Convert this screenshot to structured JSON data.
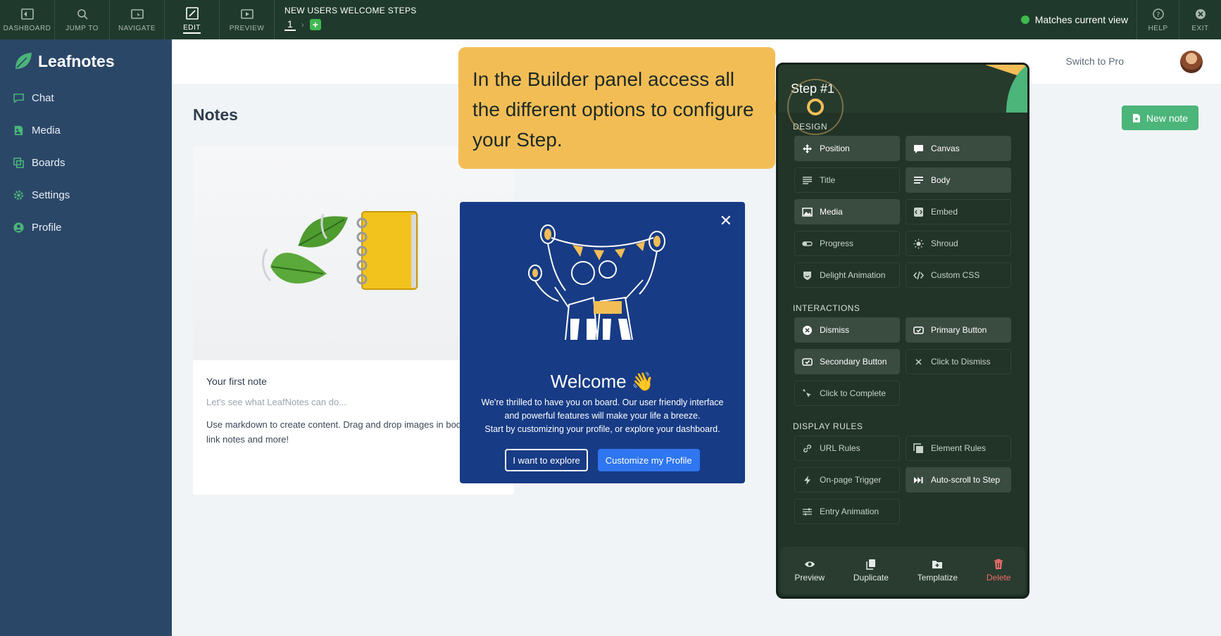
{
  "toolbar": {
    "dashboard": "DASHBOARD",
    "jump_to": "JUMP TO",
    "navigate": "NAVIGATE",
    "edit": "EDIT",
    "preview": "PREVIEW",
    "flow_name": "NEW USERS WELCOME STEPS",
    "current_step": "1",
    "match_status": "Matches current view",
    "help": "HELP",
    "exit": "EXIT"
  },
  "app": {
    "logo": "Leafnotes",
    "nav": [
      "Chat",
      "Media",
      "Boards",
      "Settings",
      "Profile"
    ],
    "switch_pro": "Switch to Pro",
    "page_title": "Notes",
    "new_note": "New note"
  },
  "note": {
    "title": "Your first note",
    "subtitle": "Let's see what LeafNotes can do...",
    "body": "Use markdown to create content. Drag and drop images in body, link notes and more!"
  },
  "tooltip": {
    "text": "In the Builder panel access all the different options to configure your Step."
  },
  "welcome": {
    "title": "Welcome 👋",
    "line1": "We're thrilled to have you on board. Our user friendly interface",
    "line2": "and powerful features will make your life a breeze.",
    "line3": "Start by customizing your profile, or explore your dashboard.",
    "secondary": "I want to explore",
    "primary": "Customize my Profile"
  },
  "builder": {
    "step": "Step #1",
    "design_title": "DESIGN",
    "design": [
      "Position",
      "Canvas",
      "Title",
      "Body",
      "Media",
      "Embed",
      "Progress",
      "Shroud",
      "Delight Animation",
      "Custom CSS"
    ],
    "interactions_title": "INTERACTIONS",
    "interactions": [
      "Dismiss",
      "Primary Button",
      "Secondary Button",
      "Click to Dismiss",
      "Click to Complete"
    ],
    "rules_title": "DISPLAY RULES",
    "rules": [
      "URL Rules",
      "Element Rules",
      "On-page Trigger",
      "Auto-scroll to Step",
      "Entry Animation"
    ],
    "footer": [
      "Preview",
      "Duplicate",
      "Templatize",
      "Delete"
    ]
  },
  "colors": {
    "toolbar": "#1f3a2c",
    "sidebar": "#2b4768",
    "tooltip": "#f3bd56",
    "modal": "#173b85",
    "builder": "#223327",
    "accent_green": "#4bb57a",
    "primary_blue": "#2f76f0"
  }
}
